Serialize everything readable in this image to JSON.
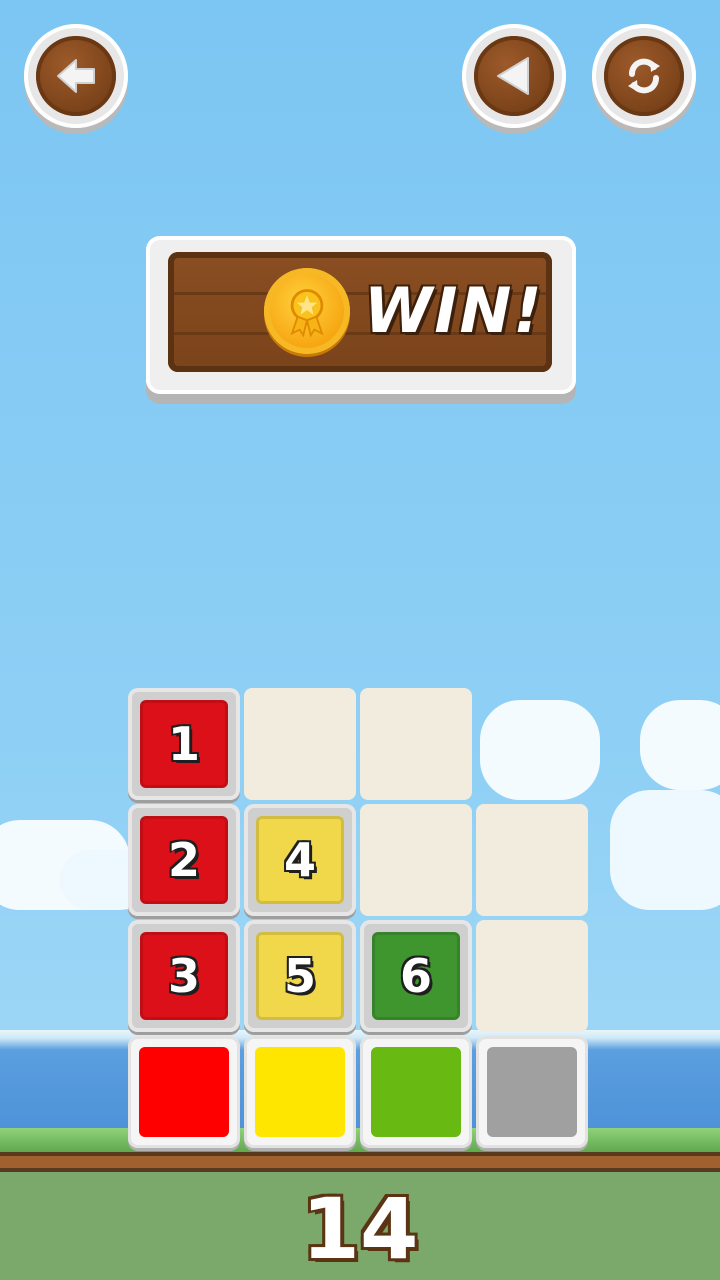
{
  "toolbar": {
    "back_icon": "arrow-left-icon",
    "undo_icon": "triangle-left-icon",
    "restart_icon": "refresh-icon"
  },
  "banner": {
    "text": "WIN!",
    "icon": "medal-icon"
  },
  "board": {
    "tiles": [
      {
        "number": "1",
        "color": "#dc1018"
      },
      {
        "number": "2",
        "color": "#dc1018"
      },
      {
        "number": "3",
        "color": "#dc1018"
      },
      {
        "number": "4",
        "color": "#f0d84a"
      },
      {
        "number": "5",
        "color": "#f0d84a"
      },
      {
        "number": "6",
        "color": "#3f962f"
      }
    ],
    "targets": [
      {
        "color": "#ff0000"
      },
      {
        "color": "#ffe600"
      },
      {
        "color": "#68ba12"
      },
      {
        "color": "#a0a0a0"
      }
    ]
  },
  "score": "14"
}
